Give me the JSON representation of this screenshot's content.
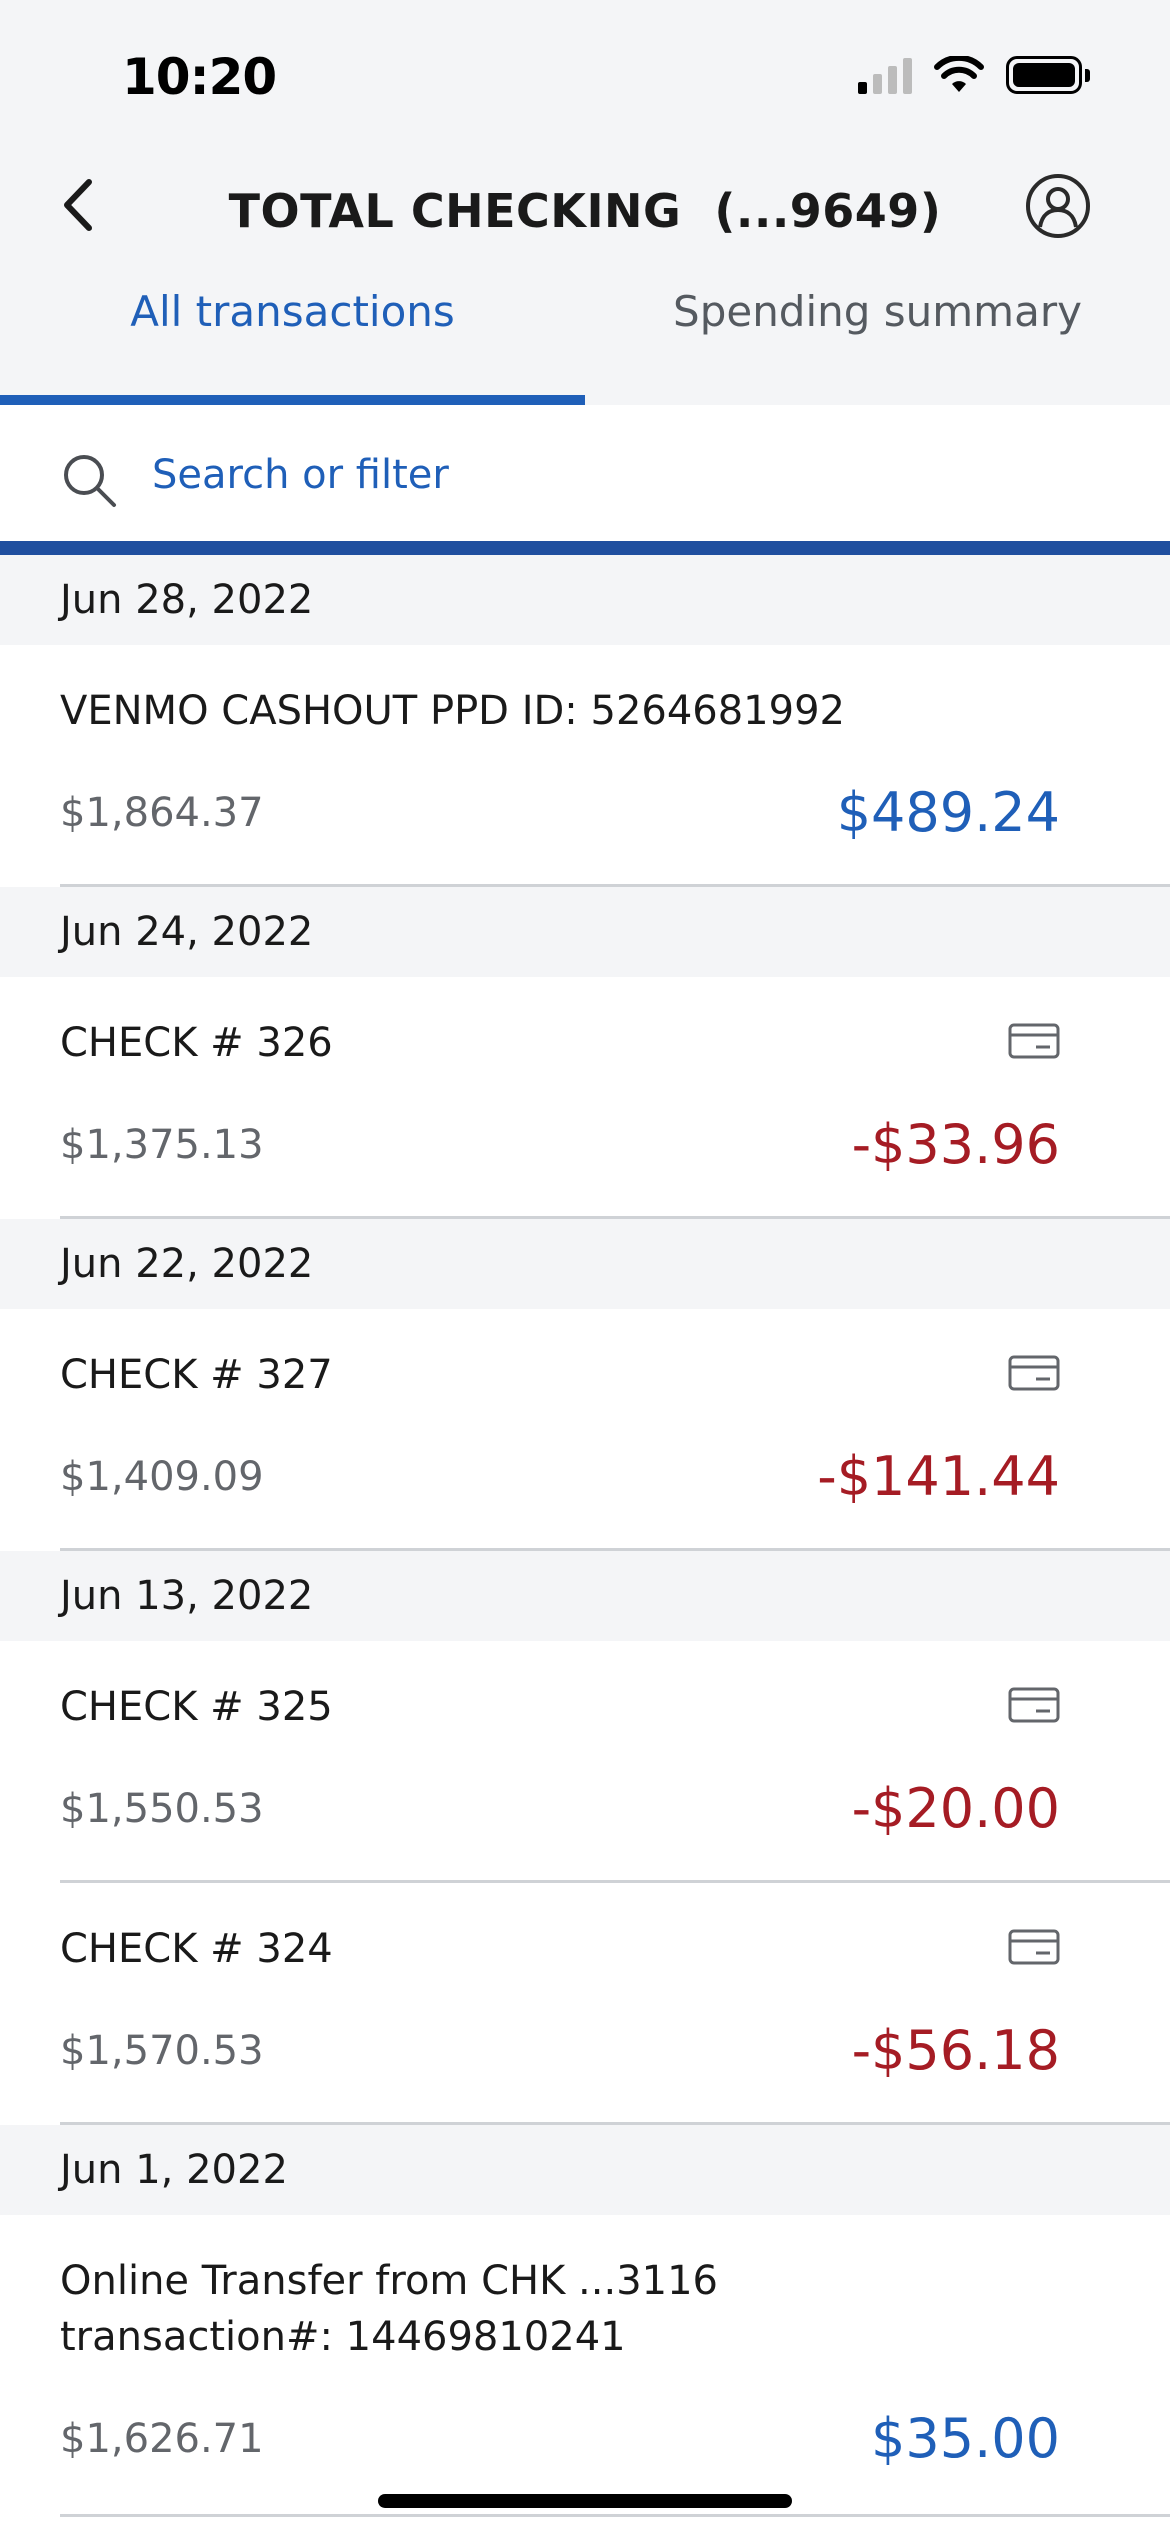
{
  "status_bar": {
    "time": "10:20"
  },
  "header": {
    "title": "TOTAL CHECKING  (...9649)"
  },
  "tabs": [
    {
      "label": "All transactions",
      "active": true
    },
    {
      "label": "Spending summary",
      "active": false
    }
  ],
  "search": {
    "placeholder": "Search or filter"
  },
  "colors": {
    "accent": "#1f5fb8",
    "negative": "#a51c24",
    "positive": "#1f5fb8"
  },
  "groups": [
    {
      "date": "Jun 28, 2022",
      "transactions": [
        {
          "description": "VENMO CASHOUT PPD ID: 5264681992",
          "balance": "$1,864.37",
          "amount": "$489.24",
          "type": "credit",
          "icon": null
        }
      ]
    },
    {
      "date": "Jun 24, 2022",
      "transactions": [
        {
          "description": "CHECK # 326",
          "balance": "$1,375.13",
          "amount": "-$33.96",
          "type": "debit",
          "icon": "check-card-icon"
        }
      ]
    },
    {
      "date": "Jun 22, 2022",
      "transactions": [
        {
          "description": "CHECK # 327",
          "balance": "$1,409.09",
          "amount": "-$141.44",
          "type": "debit",
          "icon": "check-card-icon"
        }
      ]
    },
    {
      "date": "Jun 13, 2022",
      "transactions": [
        {
          "description": "CHECK # 325",
          "balance": "$1,550.53",
          "amount": "-$20.00",
          "type": "debit",
          "icon": "check-card-icon"
        },
        {
          "description": "CHECK # 324",
          "balance": "$1,570.53",
          "amount": "-$56.18",
          "type": "debit",
          "icon": "check-card-icon"
        }
      ]
    },
    {
      "date": "Jun 1, 2022",
      "transactions": [
        {
          "description": "Online Transfer from CHK ...3116 transaction#: 14469810241",
          "balance": "$1,626.71",
          "amount": "$35.00",
          "type": "credit",
          "icon": null
        }
      ]
    }
  ]
}
